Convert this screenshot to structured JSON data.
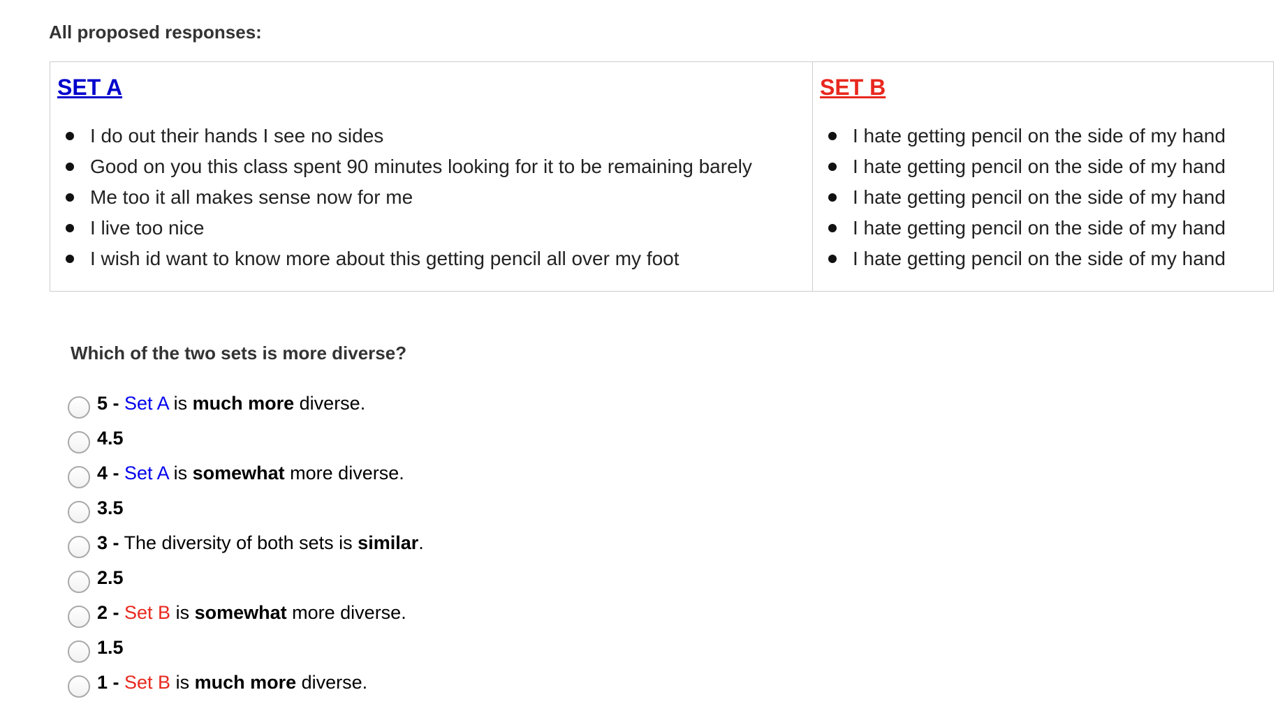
{
  "heading": "All proposed responses:",
  "set_a": {
    "title": "SET A",
    "color": "#0000cc",
    "items": [
      "I do out their hands I see no sides",
      "Good on you this class spent 90 minutes looking for it to be remaining barely",
      "Me too it all makes sense now for me",
      "I live too nice",
      "I wish id want to know more about this getting pencil all over my foot"
    ]
  },
  "set_b": {
    "title": "SET B",
    "color": "#e8281e",
    "items": [
      "I hate getting pencil on the side of my hand",
      "I hate getting pencil on the side of my hand",
      "I hate getting pencil on the side of my hand",
      "I hate getting pencil on the side of my hand",
      "I hate getting pencil on the side of my hand"
    ]
  },
  "question": "Which of the two sets is more diverse?",
  "options": [
    {
      "num": "5 -",
      "set": "Set A",
      "is": " is ",
      "degree": "much more",
      "rest": " diverse."
    },
    {
      "num": "4.5"
    },
    {
      "num": "4 -",
      "set": "Set A",
      "is": " is ",
      "degree": "somewhat",
      "rest": " more diverse."
    },
    {
      "num": "3.5"
    },
    {
      "num": "3 -",
      "pre": "The diversity of both sets is ",
      "degree": "similar",
      "rest": "."
    },
    {
      "num": "2.5"
    },
    {
      "num": "2 -",
      "set": "Set B",
      "is": " is ",
      "degree": "somewhat",
      "rest": " more diverse."
    },
    {
      "num": "1.5"
    },
    {
      "num": "1 -",
      "set": "Set B",
      "is": " is ",
      "degree": "much more",
      "rest": " diverse."
    }
  ]
}
